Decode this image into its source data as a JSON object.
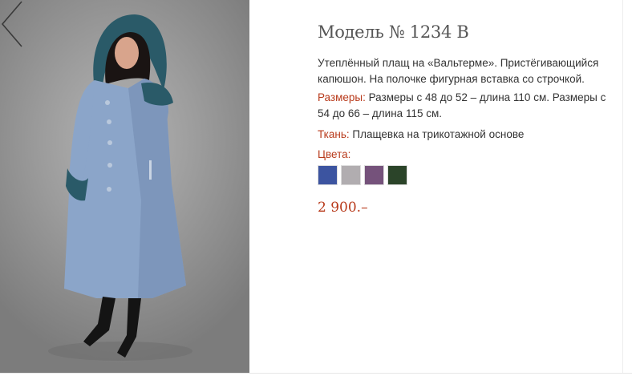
{
  "product": {
    "title": "Модель № 1234 В",
    "description": "Утеплённый плащ на «Вальтерме».  Пристёгивающийся капюшон. На полочке фигурная вставка со строчкой.",
    "sizes": {
      "label": "Размеры:",
      "value": "Размеры с 48 до 52 – длина 110 см. Размеры с 54 до 66 – длина 115 см."
    },
    "fabric": {
      "label": "Ткань:",
      "value": "Плащевка на трикотажной основе"
    },
    "colors": {
      "label": "Цвета:",
      "swatches": [
        "#3c54a0",
        "#b1adb0",
        "#75527b",
        "#2b4429"
      ]
    },
    "price": "2 900.–"
  },
  "gallery": {
    "prev_icon": "chevron-left-icon"
  },
  "theme": {
    "accent": "#b83a1b",
    "coat": "#8ba5c9",
    "fur": "#2a5a68"
  }
}
